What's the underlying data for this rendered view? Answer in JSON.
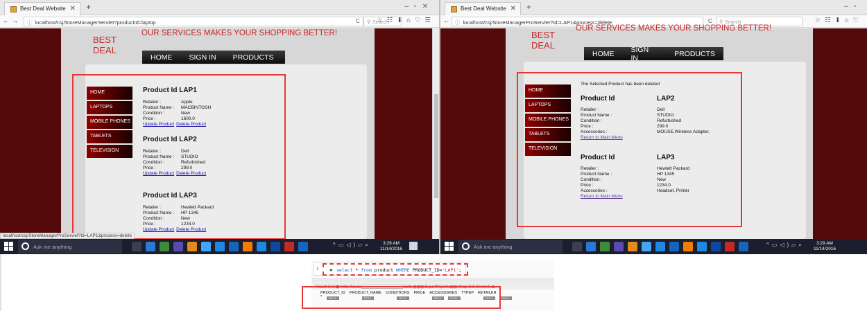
{
  "left": {
    "tab_title": "Best Deal Website",
    "url": "localhost/csj/StoreManagerServlet?productId=laptop",
    "search_placeholder": "Search",
    "brand": [
      "BEST",
      "DEAL"
    ],
    "tagline": "OUR SERVICES MAKES YOUR SHOPPING BETTER!",
    "nav": [
      "HOME",
      "SIGN IN",
      "PRODUCTS"
    ],
    "menu": [
      "HOME",
      "LAPTOPS",
      "MOBILE PHONES",
      "TABLETS",
      "TELEVISION"
    ],
    "products": [
      {
        "heading": "Product Id LAP1",
        "rows": [
          [
            "Retailer :",
            "Apple"
          ],
          [
            "Product Name :",
            "MACBINTOSH"
          ],
          [
            "Condition :",
            "New"
          ],
          [
            "Price :",
            "1600.0"
          ]
        ],
        "update": "Update Product",
        "delete": "Delete Product"
      },
      {
        "heading": "Product Id LAP2",
        "rows": [
          [
            "Retailer :",
            "Dell"
          ],
          [
            "Product Name :",
            "STUDIO"
          ],
          [
            "Condition :",
            "Refurbished"
          ],
          [
            "Price :",
            "299.0"
          ]
        ],
        "update": "Update Product",
        "delete": "Delete Product"
      },
      {
        "heading": "Product Id LAP3",
        "rows": [
          [
            "Retailer :",
            "Hewlett Packard"
          ],
          [
            "Product Name :",
            "HP 1345"
          ],
          [
            "Condition :",
            "New"
          ],
          [
            "Price :",
            "1234.0"
          ]
        ],
        "update": "Update Product",
        "delete": "Delete Product"
      }
    ],
    "status_url": "localhost/csj/StoreManagerProServlet?Id=LAP1&process=delete",
    "search_hint": "Ask me anything",
    "clock_time": "3:29 AM",
    "clock_date": "11/14/2016"
  },
  "right": {
    "tab_title": "Best Deal Website",
    "url": "localhost/csj/StoreManagerProServlet?Id=LAP1&process=delete",
    "search_placeholder": "Search",
    "brand": [
      "BEST",
      "DEAL"
    ],
    "tagline": "OUR SERVICES MAKES YOUR SHOPPING BETTER!",
    "nav": [
      "HOME",
      "SIGN IN",
      "PRODUCTS"
    ],
    "menu": [
      "HOME",
      "LAPTOPS",
      "MOBILE PHONES",
      "TABLETS",
      "TELEVISION"
    ],
    "message": "The Selected Product has been deleted",
    "products": [
      {
        "label": "Product Id",
        "id": "LAP2",
        "rows": [
          [
            "Retailer :",
            "Dell"
          ],
          [
            "Product Name :",
            "STUDIO"
          ],
          [
            "Condition :",
            "Refurbished"
          ],
          [
            "Price :",
            "299.0"
          ],
          [
            "Accessories :",
            "MOUSE,Wireless Adapter,"
          ]
        ],
        "link": "Return to Main Menu"
      },
      {
        "label": "Product Id",
        "id": "LAP3",
        "rows": [
          [
            "Retailer :",
            "Hewlett Packard"
          ],
          [
            "Product Name :",
            "HP 1345"
          ],
          [
            "Condition :",
            "New"
          ],
          [
            "Price :",
            "1234.0"
          ],
          [
            "Accessories :",
            "Headset, Printer"
          ]
        ],
        "link": "Return to Main Menu"
      }
    ],
    "search_hint": "Ask me anything",
    "clock_time": "3:29 AM",
    "clock_date": "11/14/2016"
  },
  "sql": {
    "line": "1",
    "query_kw1": "select",
    "query_mid": " * ",
    "query_kw2": "from",
    "query_mid2": " product ",
    "query_kw3": "WHERE",
    "query_mid3": " PRODUCT_ID=",
    "query_str": "'LAP1'",
    "query_end": ";",
    "toolbar_result": "Result Grid",
    "toolbar_filter": "Filter Rows:",
    "toolbar_edit": "Edit:",
    "toolbar_export": "Export/Import:",
    "toolbar_wrap": "Wrap Cell Content:",
    "columns": [
      "PRODUCT_ID",
      "PRODUCT_NAME",
      "CONDITIONS",
      "PRICE",
      "ACCESSORIES",
      "TYPEP",
      "RETAILER"
    ],
    "null_label": "NULL",
    "row_marker": "*"
  }
}
